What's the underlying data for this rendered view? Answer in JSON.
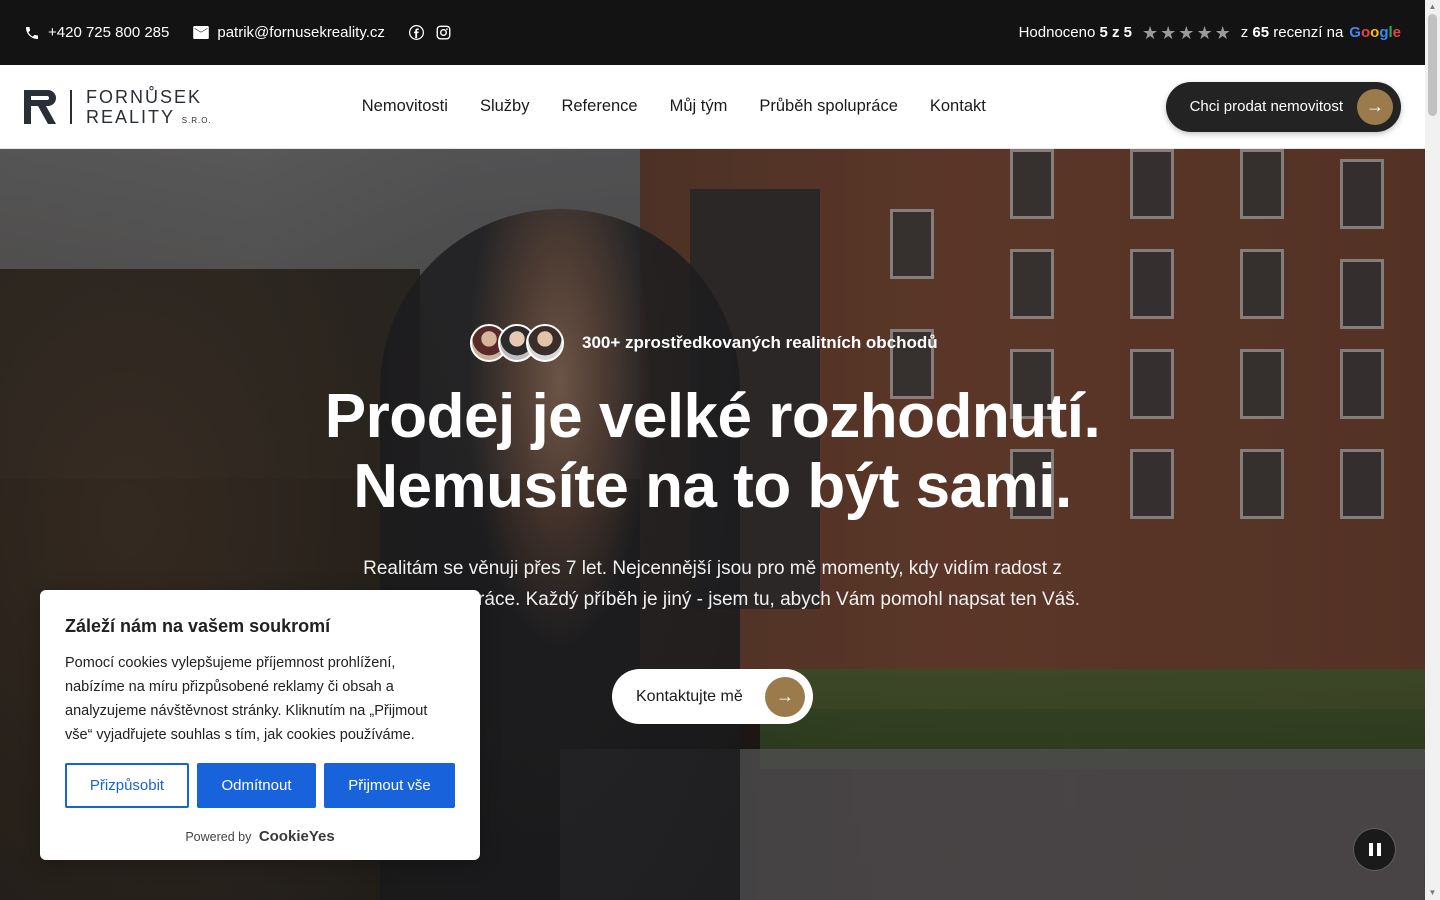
{
  "topbar": {
    "phone": "+420 725 800 285",
    "email": "patrik@fornusekreality.cz",
    "rating_prefix": "Hodnoceno",
    "rating_value": "5 z 5",
    "rating_count_prefix": "z",
    "rating_count": "65",
    "rating_count_suffix": "recenzí na",
    "google_letters": [
      "G",
      "o",
      "o",
      "g",
      "l",
      "e"
    ]
  },
  "header": {
    "logo_line1": "FORNŮSEK",
    "logo_line2": "REALITY",
    "logo_suffix": "S.R.O.",
    "nav": [
      "Nemovitosti",
      "Služby",
      "Reference",
      "Můj tým",
      "Průběh spolupráce",
      "Kontakt"
    ],
    "cta": "Chci prodat nemovitost"
  },
  "hero": {
    "badge": "300+ zprostředkovaných realitních obchodů",
    "title_line1": "Prodej je velké rozhodnutí.",
    "title_line2": "Nemusíte na to být sami.",
    "lead": "Realitám se věnuji přes 7 let. Nejcennější jsou pro mě momenty, kdy vidím radost z úspěšné spolupráce. Každý příběh je jiný - jsem tu, abych Vám pomohl napsat ten Váš.",
    "cta": "Kontaktujte mě"
  },
  "cookie": {
    "title": "Záleží nám na vašem soukromí",
    "text": "Pomocí cookies vylepšujeme příjemnost prohlížení, nabízíme na míru přizpůsobené reklamy či obsah a analyzujeme návštěvnost stránky. Kliknutím na „Přijmout vše“ vyjadřujete souhlas s tím, jak cookies používáme.",
    "customize": "Přizpůsobit",
    "reject": "Odmítnout",
    "accept": "Přijmout vše",
    "powered_by": "Powered by",
    "brand": "CookieYes"
  },
  "colors": {
    "accent_gold": "#9b7a4c",
    "topbar_bg": "#131313",
    "cookie_blue": "#1863dc"
  },
  "icons": [
    "phone-icon",
    "mail-icon",
    "facebook-icon",
    "instagram-icon",
    "star-icon",
    "arrow-right-icon",
    "pause-icon"
  ]
}
